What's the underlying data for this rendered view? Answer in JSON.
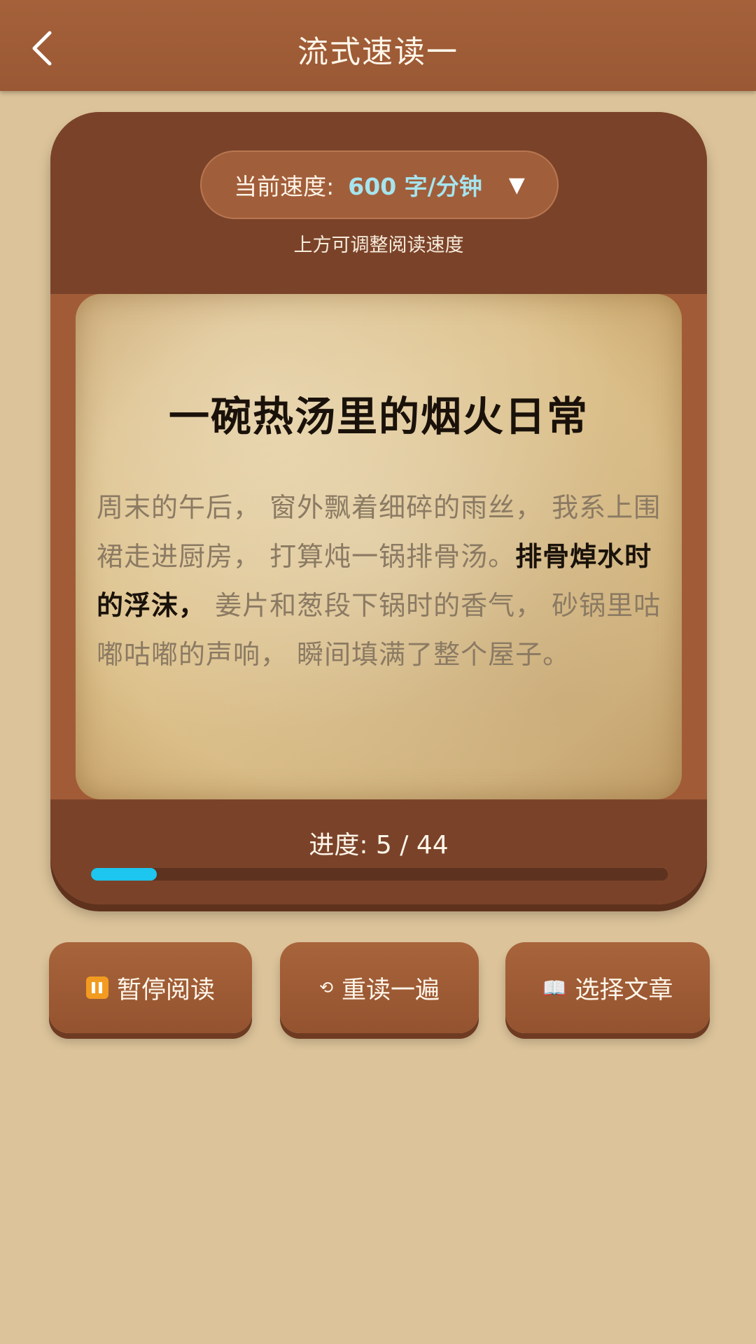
{
  "header": {
    "title": "流式速读一"
  },
  "speed": {
    "label": "当前速度:",
    "value": "600 字/分钟",
    "hint": "上方可调整阅读速度"
  },
  "article": {
    "title": "一碗热汤里的烟火日常",
    "text_before": "周末的午后， 窗外飘着细碎的雨丝， 我系上围裙走进厨房， 打算炖一锅排骨汤。",
    "text_current": "排骨焯水时的浮沫，",
    "text_after": " 姜片和葱段下锅时的香气， 砂锅里咕嘟咕嘟的声响， 瞬间填满了整个屋子。"
  },
  "progress": {
    "label": "进度: 5 / 44",
    "current": 5,
    "total": 44,
    "color": "#1cc6ee"
  },
  "buttons": {
    "pause": {
      "icon": "pause-icon",
      "label": "暂停阅读"
    },
    "reread": {
      "icon": "reread-icon",
      "label": "重读一遍"
    },
    "select": {
      "icon": "book-icon",
      "label": "选择文章"
    }
  }
}
